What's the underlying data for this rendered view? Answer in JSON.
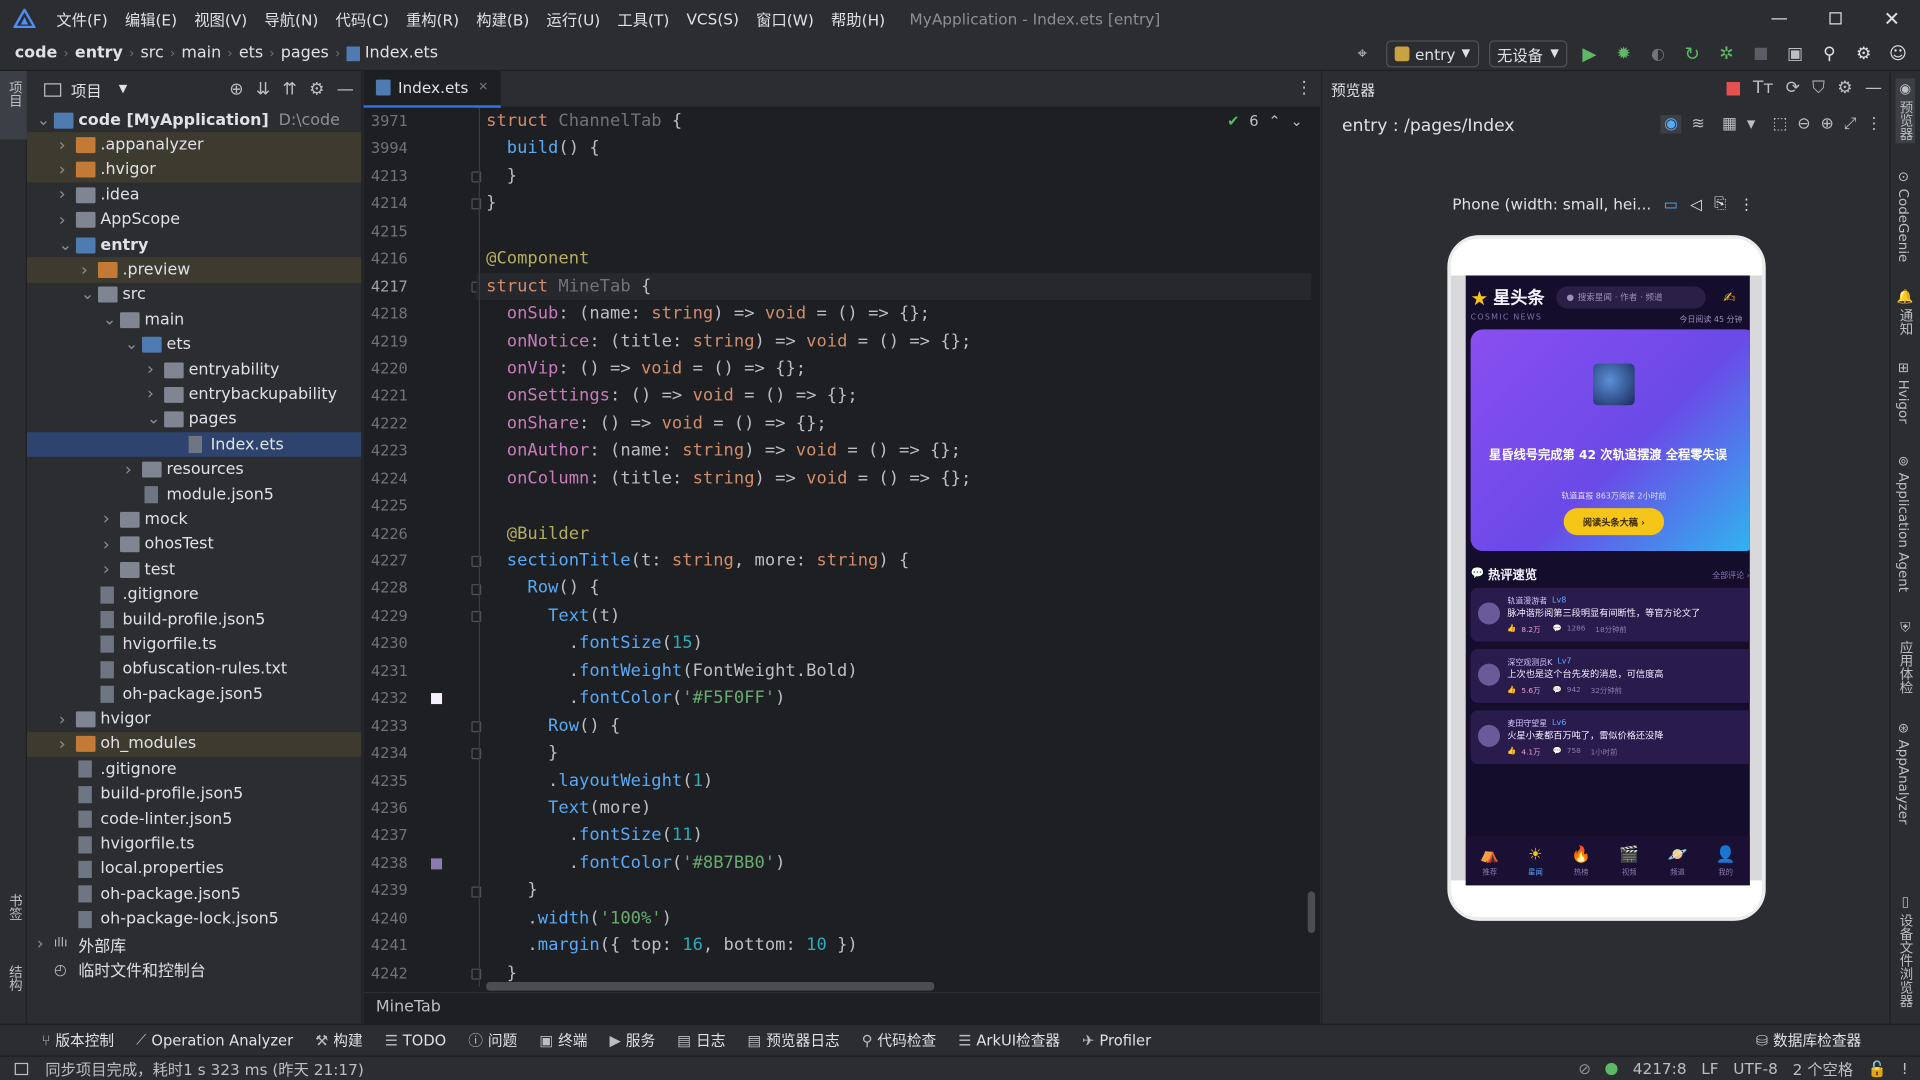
{
  "titlebar": {
    "menus": [
      "文件(F)",
      "编辑(E)",
      "视图(V)",
      "导航(N)",
      "代码(C)",
      "重构(R)",
      "构建(B)",
      "运行(U)",
      "工具(T)",
      "VCS(S)",
      "窗口(W)",
      "帮助(H)"
    ],
    "window_title": "MyApplication - Index.ets [entry]"
  },
  "breadcrumb": [
    "code",
    "entry",
    "src",
    "main",
    "ets",
    "pages",
    "Index.ets"
  ],
  "run_config": {
    "module": "entry",
    "device": "无设备"
  },
  "left_strip": {
    "top": "项目",
    "bottom1": "书签",
    "bottom2": "结构"
  },
  "project": {
    "header": "项目",
    "tree": [
      {
        "label": "code [MyApplication]",
        "extra": "D:\\code",
        "depth": 0,
        "arrow": "down",
        "icon": "folder-b",
        "bold": true
      },
      {
        "label": ".appanalyzer",
        "depth": 1,
        "arrow": "right",
        "icon": "folder-o",
        "hl": true
      },
      {
        "label": ".hvigor",
        "depth": 1,
        "arrow": "right",
        "icon": "folder-o",
        "hl": true
      },
      {
        "label": ".idea",
        "depth": 1,
        "arrow": "right",
        "icon": "folder"
      },
      {
        "label": "AppScope",
        "depth": 1,
        "arrow": "right",
        "icon": "folder"
      },
      {
        "label": "entry",
        "depth": 1,
        "arrow": "down",
        "icon": "folder-b",
        "bold": true
      },
      {
        "label": ".preview",
        "depth": 2,
        "arrow": "right",
        "icon": "folder-o",
        "hl": true
      },
      {
        "label": "src",
        "depth": 2,
        "arrow": "down",
        "icon": "folder"
      },
      {
        "label": "main",
        "depth": 3,
        "arrow": "down",
        "icon": "folder"
      },
      {
        "label": "ets",
        "depth": 4,
        "arrow": "down",
        "icon": "folder-b"
      },
      {
        "label": "entryability",
        "depth": 5,
        "arrow": "right",
        "icon": "folder"
      },
      {
        "label": "entrybackupability",
        "depth": 5,
        "arrow": "right",
        "icon": "folder"
      },
      {
        "label": "pages",
        "depth": 5,
        "arrow": "down",
        "icon": "folder"
      },
      {
        "label": "Index.ets",
        "depth": 6,
        "arrow": "",
        "icon": "file",
        "selected": true
      },
      {
        "label": "resources",
        "depth": 4,
        "arrow": "right",
        "icon": "folder"
      },
      {
        "label": "module.json5",
        "depth": 4,
        "arrow": "",
        "icon": "file"
      },
      {
        "label": "mock",
        "depth": 3,
        "arrow": "right",
        "icon": "folder"
      },
      {
        "label": "ohosTest",
        "depth": 3,
        "arrow": "right",
        "icon": "folder"
      },
      {
        "label": "test",
        "depth": 3,
        "arrow": "right",
        "icon": "folder"
      },
      {
        "label": ".gitignore",
        "depth": 2,
        "arrow": "",
        "icon": "file"
      },
      {
        "label": "build-profile.json5",
        "depth": 2,
        "arrow": "",
        "icon": "file"
      },
      {
        "label": "hvigorfile.ts",
        "depth": 2,
        "arrow": "",
        "icon": "file"
      },
      {
        "label": "obfuscation-rules.txt",
        "depth": 2,
        "arrow": "",
        "icon": "file"
      },
      {
        "label": "oh-package.json5",
        "depth": 2,
        "arrow": "",
        "icon": "file"
      },
      {
        "label": "hvigor",
        "depth": 1,
        "arrow": "right",
        "icon": "folder"
      },
      {
        "label": "oh_modules",
        "depth": 1,
        "arrow": "right",
        "icon": "folder-o",
        "hl": true
      },
      {
        "label": ".gitignore",
        "depth": 1,
        "arrow": "",
        "icon": "file"
      },
      {
        "label": "build-profile.json5",
        "depth": 1,
        "arrow": "",
        "icon": "file"
      },
      {
        "label": "code-linter.json5",
        "depth": 1,
        "arrow": "",
        "icon": "file"
      },
      {
        "label": "hvigorfile.ts",
        "depth": 1,
        "arrow": "",
        "icon": "file"
      },
      {
        "label": "local.properties",
        "depth": 1,
        "arrow": "",
        "icon": "file"
      },
      {
        "label": "oh-package.json5",
        "depth": 1,
        "arrow": "",
        "icon": "file"
      },
      {
        "label": "oh-package-lock.json5",
        "depth": 1,
        "arrow": "",
        "icon": "file"
      },
      {
        "label": "外部库",
        "depth": 0,
        "arrow": "right",
        "icon": "lib"
      },
      {
        "label": "临时文件和控制台",
        "depth": 0,
        "arrow": "",
        "icon": "scratch"
      }
    ]
  },
  "editor": {
    "tab": "Index.ets",
    "inspection_count": "6",
    "breadcrumb": "MineTab",
    "line_numbers": [
      "3971",
      "3994",
      "4213",
      "4214",
      "4215",
      "4216",
      "4217",
      "4218",
      "4219",
      "4220",
      "4221",
      "4222",
      "4223",
      "4224",
      "4225",
      "4226",
      "4227",
      "4228",
      "4229",
      "4230",
      "4231",
      "4232",
      "4233",
      "4234",
      "4235",
      "4236",
      "4237",
      "4238",
      "4239",
      "4240",
      "4241",
      "4242"
    ],
    "current_line": "4217",
    "code_lines": [
      [
        [
          "kw",
          "struct "
        ],
        [
          "dim",
          "ChannelTab"
        ],
        [
          "cls",
          " {"
        ]
      ],
      [
        [
          "cls",
          "  "
        ],
        [
          "fn",
          "build"
        ],
        [
          "cls",
          "() {"
        ]
      ],
      [
        [
          "cls",
          "  }"
        ]
      ],
      [
        [
          "cls",
          "}"
        ]
      ],
      [
        [
          "cls",
          ""
        ]
      ],
      [
        [
          "an",
          "@Component"
        ]
      ],
      [
        [
          "kw",
          "struct "
        ],
        [
          "dim",
          "MineTab"
        ],
        [
          "cls",
          " {"
        ]
      ],
      [
        [
          "cls",
          "  "
        ],
        [
          "pr",
          "onSub"
        ],
        [
          "cls",
          ": ("
        ],
        [
          "cls",
          "name"
        ],
        [
          "cls",
          ": "
        ],
        [
          "kw",
          "string"
        ],
        [
          "cls",
          ") => "
        ],
        [
          "kw",
          "void"
        ],
        [
          "cls",
          " = () => {};"
        ]
      ],
      [
        [
          "cls",
          "  "
        ],
        [
          "pr",
          "onNotice"
        ],
        [
          "cls",
          ": ("
        ],
        [
          "cls",
          "title"
        ],
        [
          "cls",
          ": "
        ],
        [
          "kw",
          "string"
        ],
        [
          "cls",
          ") => "
        ],
        [
          "kw",
          "void"
        ],
        [
          "cls",
          " = () => {};"
        ]
      ],
      [
        [
          "cls",
          "  "
        ],
        [
          "pr",
          "onVip"
        ],
        [
          "cls",
          ": () => "
        ],
        [
          "kw",
          "void"
        ],
        [
          "cls",
          " = () => {};"
        ]
      ],
      [
        [
          "cls",
          "  "
        ],
        [
          "pr",
          "onSettings"
        ],
        [
          "cls",
          ": () => "
        ],
        [
          "kw",
          "void"
        ],
        [
          "cls",
          " = () => {};"
        ]
      ],
      [
        [
          "cls",
          "  "
        ],
        [
          "pr",
          "onShare"
        ],
        [
          "cls",
          ": () => "
        ],
        [
          "kw",
          "void"
        ],
        [
          "cls",
          " = () => {};"
        ]
      ],
      [
        [
          "cls",
          "  "
        ],
        [
          "pr",
          "onAuthor"
        ],
        [
          "cls",
          ": ("
        ],
        [
          "cls",
          "name"
        ],
        [
          "cls",
          ": "
        ],
        [
          "kw",
          "string"
        ],
        [
          "cls",
          ") => "
        ],
        [
          "kw",
          "void"
        ],
        [
          "cls",
          " = () => {};"
        ]
      ],
      [
        [
          "cls",
          "  "
        ],
        [
          "pr",
          "onColumn"
        ],
        [
          "cls",
          ": ("
        ],
        [
          "cls",
          "title"
        ],
        [
          "cls",
          ": "
        ],
        [
          "kw",
          "string"
        ],
        [
          "cls",
          ") => "
        ],
        [
          "kw",
          "void"
        ],
        [
          "cls",
          " = () => {};"
        ]
      ],
      [
        [
          "cls",
          ""
        ]
      ],
      [
        [
          "cls",
          "  "
        ],
        [
          "an",
          "@Builder"
        ]
      ],
      [
        [
          "cls",
          "  "
        ],
        [
          "fn",
          "sectionTitle"
        ],
        [
          "cls",
          "(t: "
        ],
        [
          "kw",
          "string"
        ],
        [
          "cls",
          ", more: "
        ],
        [
          "kw",
          "string"
        ],
        [
          "cls",
          ") {"
        ]
      ],
      [
        [
          "cls",
          "    "
        ],
        [
          "fn",
          "Row"
        ],
        [
          "cls",
          "() {"
        ]
      ],
      [
        [
          "cls",
          "      "
        ],
        [
          "fn",
          "Text"
        ],
        [
          "cls",
          "(t)"
        ]
      ],
      [
        [
          "cls",
          "        ."
        ],
        [
          "fn",
          "fontSize"
        ],
        [
          "cls",
          "("
        ],
        [
          "nm",
          "15"
        ],
        [
          "cls",
          ")"
        ]
      ],
      [
        [
          "cls",
          "        ."
        ],
        [
          "fn",
          "fontWeight"
        ],
        [
          "cls",
          "(FontWeight.Bold)"
        ]
      ],
      [
        [
          "cls",
          "        ."
        ],
        [
          "fn",
          "fontColor"
        ],
        [
          "cls",
          "("
        ],
        [
          "st",
          "'#F5F0FF'"
        ],
        [
          "cls",
          ")"
        ]
      ],
      [
        [
          "cls",
          "      "
        ],
        [
          "fn",
          "Row"
        ],
        [
          "cls",
          "() {"
        ]
      ],
      [
        [
          "cls",
          "      }"
        ]
      ],
      [
        [
          "cls",
          "      ."
        ],
        [
          "fn",
          "layoutWeight"
        ],
        [
          "cls",
          "("
        ],
        [
          "nm",
          "1"
        ],
        [
          "cls",
          ")"
        ]
      ],
      [
        [
          "cls",
          "      "
        ],
        [
          "fn",
          "Text"
        ],
        [
          "cls",
          "(more)"
        ]
      ],
      [
        [
          "cls",
          "        ."
        ],
        [
          "fn",
          "fontSize"
        ],
        [
          "cls",
          "("
        ],
        [
          "nm",
          "11"
        ],
        [
          "cls",
          ")"
        ]
      ],
      [
        [
          "cls",
          "        ."
        ],
        [
          "fn",
          "fontColor"
        ],
        [
          "cls",
          "("
        ],
        [
          "st",
          "'#8B7BB0'"
        ],
        [
          "cls",
          ")"
        ]
      ],
      [
        [
          "cls",
          "    }"
        ]
      ],
      [
        [
          "cls",
          "    ."
        ],
        [
          "fn",
          "width"
        ],
        [
          "cls",
          "("
        ],
        [
          "st",
          "'100%'"
        ],
        [
          "cls",
          ")"
        ]
      ],
      [
        [
          "cls",
          "    ."
        ],
        [
          "fn",
          "margin"
        ],
        [
          "cls",
          "({ top: "
        ],
        [
          "nm",
          "16"
        ],
        [
          "cls",
          ", bottom: "
        ],
        [
          "nm",
          "10"
        ],
        [
          "cls",
          " })"
        ]
      ],
      [
        [
          "cls",
          "  }"
        ]
      ]
    ]
  },
  "preview": {
    "panel_title": "预览器",
    "route": "entry : /pages/Index",
    "device_label": "Phone (width: small, hei...",
    "app": {
      "brand": "星头条",
      "subtitle": "COSMIC NEWS",
      "search_placeholder": "搜索星闻 · 作者 · 频道",
      "read_today": "今日阅读 45 分钟",
      "hero_title": "星昏线号完成第 42 次轨道摆渡 全程零失误",
      "hero_meta": "轨道直报    863万阅读    2小时前",
      "hero_button": "阅读头条大稿 ›",
      "section_title": "热评速览",
      "section_more": "全部评论 ›",
      "comments": [
        {
          "user": "轨道漫游者",
          "level": "Lv8",
          "text": "脉冲谐形阅第三段明显有间断性，等官方论文了",
          "likes": "8.2万",
          "replies": "1286",
          "time": "18分钟前"
        },
        {
          "user": "深空观测员K",
          "level": "Lv7",
          "text": "上次也是这个台先发的消息，可信度高",
          "likes": "5.6万",
          "replies": "942",
          "time": "32分钟前"
        },
        {
          "user": "麦田守望星",
          "level": "Lv6",
          "text": "火星小麦都百万吨了，雷似价格还没降",
          "likes": "4.1万",
          "replies": "758",
          "time": "1小时前"
        }
      ],
      "nav": [
        "推荐",
        "星闻",
        "热榜",
        "视频",
        "频道",
        "我的"
      ]
    }
  },
  "right_strip": [
    "预览器",
    "CodeGenie",
    "通知",
    "Hvigor",
    "Application Agent",
    "应用体检",
    "AppAnalyzer",
    "设备文件浏览器"
  ],
  "bottom_tools": [
    "版本控制",
    "Operation Analyzer",
    "构建",
    "TODO",
    "问题",
    "终端",
    "服务",
    "日志",
    "预览器日志",
    "代码检查",
    "ArkUI检查器",
    "Profiler",
    "数据库检查器"
  ],
  "status": {
    "message": "同步项目完成，耗时1 s 323 ms (昨天 21:17)",
    "position": "4217:8",
    "line_sep": "LF",
    "encoding": "UTF-8",
    "indent": "2 个空格"
  },
  "colors": {
    "accent": "#3574f0",
    "run": "#5fb865",
    "phone_bg": "#140d2b",
    "hero_from": "#7b4df0",
    "hero_to": "#2db8f0",
    "gold": "#f5c518"
  }
}
